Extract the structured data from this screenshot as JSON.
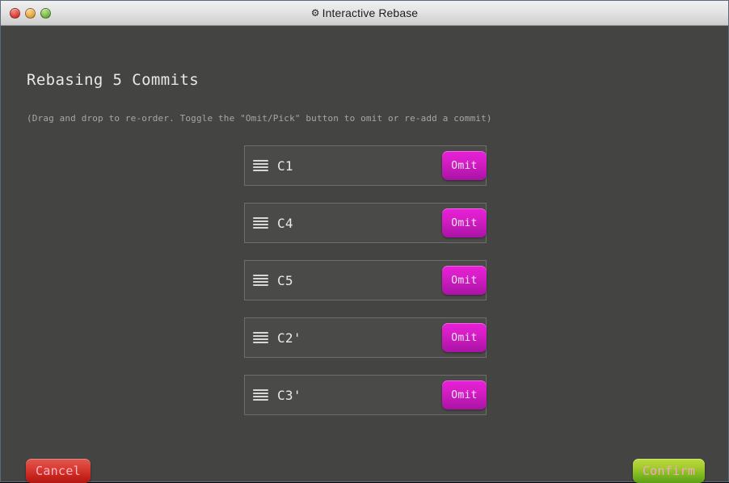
{
  "window": {
    "title": "Interactive Rebase",
    "title_icon": "gear-icon",
    "traffic_lights": [
      {
        "name": "close-button",
        "color": "#e0453c"
      },
      {
        "name": "minimize-button",
        "color": "#e8ab45"
      },
      {
        "name": "maximize-button",
        "color": "#79bb4a"
      }
    ]
  },
  "main": {
    "heading": "Rebasing 5 Commits",
    "subheading": "(Drag and drop to re-order. Toggle the \"Omit/Pick\" button to omit or re-add a commit)",
    "commits": [
      {
        "label": "C1",
        "action_label": "Omit",
        "handle_icon": "drag-handle-icon"
      },
      {
        "label": "C4",
        "action_label": "Omit",
        "handle_icon": "drag-handle-icon"
      },
      {
        "label": "C5",
        "action_label": "Omit",
        "handle_icon": "drag-handle-icon"
      },
      {
        "label": "C2'",
        "action_label": "Omit",
        "handle_icon": "drag-handle-icon"
      },
      {
        "label": "C3'",
        "action_label": "Omit",
        "handle_icon": "drag-handle-icon"
      }
    ]
  },
  "footer": {
    "cancel_label": "Cancel",
    "confirm_label": "Confirm"
  },
  "colors": {
    "window_background": "#444442",
    "row_background": "#4a4a48",
    "row_border": "#6d6d6b",
    "omit_accent": "#d81ec8",
    "cancel_accent": "#d93c33",
    "confirm_accent": "#a5cc2e",
    "titlebar_top": "#f0f0f0",
    "titlebar_bottom": "#cdcdcd",
    "heading_text": "#e9e9e9",
    "subheading_text": "#a7a7a5"
  }
}
